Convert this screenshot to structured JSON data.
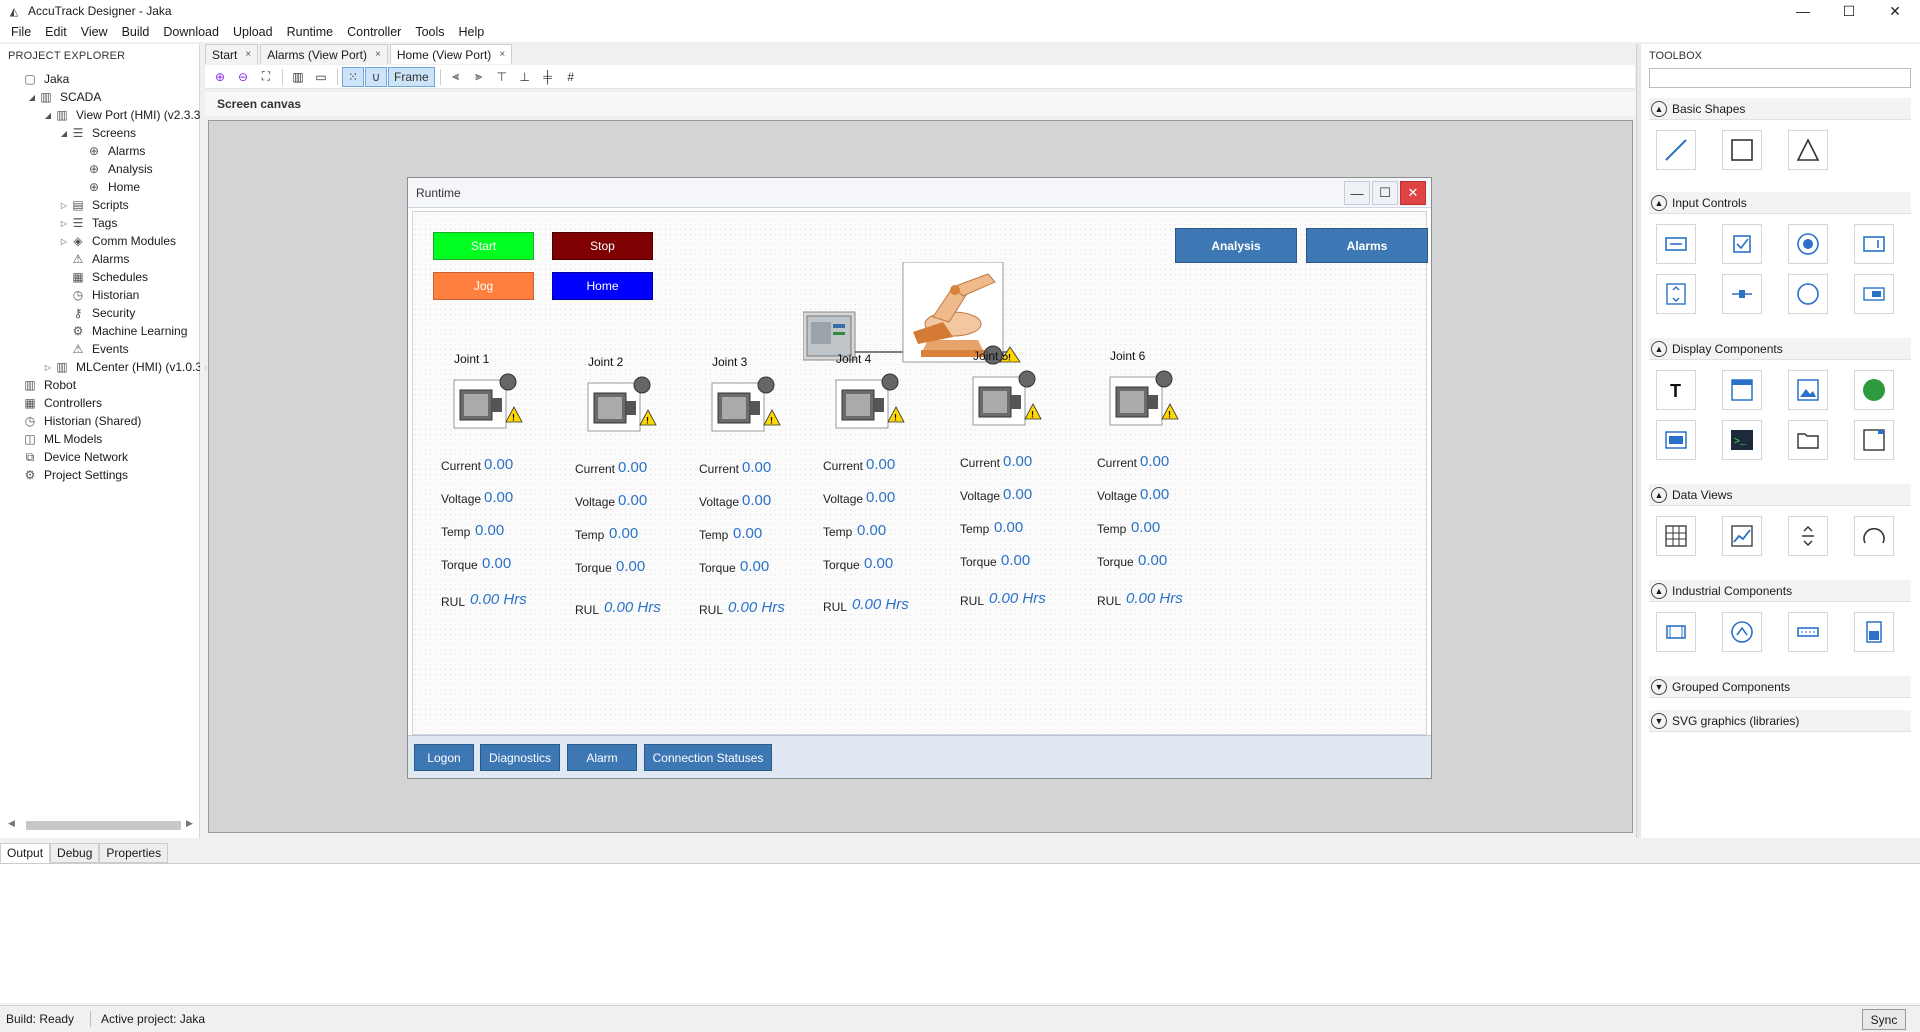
{
  "window": {
    "title": "AccuTrack Designer - Jaka",
    "min": "—",
    "max": "☐",
    "close": "✕"
  },
  "menu": [
    "File",
    "Edit",
    "View",
    "Build",
    "Download",
    "Upload",
    "Runtime",
    "Controller",
    "Tools",
    "Help"
  ],
  "explorer": {
    "header": "PROJECT EXPLORER",
    "items": [
      {
        "label": "Jaka",
        "icon": "file-icon",
        "arrow": ""
      },
      {
        "label": "SCADA",
        "icon": "library-icon",
        "arrow": "◢"
      },
      {
        "label": "View Port (HMI) (v2.3.3)",
        "icon": "library-icon",
        "arrow": "◢"
      },
      {
        "label": "Screens",
        "icon": "list-icon",
        "arrow": "◢"
      },
      {
        "label": "Alarms",
        "icon": "globe-icon",
        "arrow": ""
      },
      {
        "label": "Analysis",
        "icon": "globe-icon",
        "arrow": ""
      },
      {
        "label": "Home",
        "icon": "globe-icon",
        "arrow": ""
      },
      {
        "label": "Scripts",
        "icon": "script-icon",
        "arrow": "▷"
      },
      {
        "label": "Tags",
        "icon": "list-icon",
        "arrow": "▷"
      },
      {
        "label": "Comm Modules",
        "icon": "comm-icon",
        "arrow": "▷"
      },
      {
        "label": "Alarms",
        "icon": "warning-icon",
        "arrow": ""
      },
      {
        "label": "Schedules",
        "icon": "calendar-icon",
        "arrow": ""
      },
      {
        "label": "Historian",
        "icon": "history-icon",
        "arrow": ""
      },
      {
        "label": "Security",
        "icon": "key-icon",
        "arrow": ""
      },
      {
        "label": "Machine Learning",
        "icon": "gear-icon",
        "arrow": ""
      },
      {
        "label": "Events",
        "icon": "warning-icon",
        "arrow": ""
      },
      {
        "label": "MLCenter (HMI) (v1.0.3)",
        "icon": "library-icon",
        "arrow": "▷"
      },
      {
        "label": "Robot",
        "icon": "library-icon",
        "arrow": ""
      },
      {
        "label": "Controllers",
        "icon": "grid-icon",
        "arrow": ""
      },
      {
        "label": "Historian (Shared)",
        "icon": "history-icon",
        "arrow": ""
      },
      {
        "label": "ML Models",
        "icon": "cube-icon",
        "arrow": ""
      },
      {
        "label": "Device Network",
        "icon": "network-icon",
        "arrow": ""
      },
      {
        "label": "Project Settings",
        "icon": "gear-icon",
        "arrow": ""
      }
    ]
  },
  "tabs": [
    {
      "label": "Start",
      "close": "×"
    },
    {
      "label": "Alarms (View Port)",
      "close": "×"
    },
    {
      "label": "Home (View Port)",
      "close": "×"
    }
  ],
  "toolbar": {
    "frame_label": "Frame"
  },
  "canvas": {
    "label": "Screen canvas"
  },
  "runtime": {
    "title": "Runtime",
    "controls": {
      "start": "Start",
      "stop": "Stop",
      "jog": "Jog",
      "home": "Home"
    },
    "nav": {
      "analysis": "Analysis",
      "alarms": "Alarms"
    },
    "labels": {
      "current": "Current",
      "voltage": "Voltage",
      "temp": "Temp",
      "torque": "Torque",
      "rul": "RUL"
    },
    "joints": [
      {
        "name": "Joint 1",
        "current": "0.00",
        "voltage": "0.00",
        "temp": "0.00",
        "torque": "0.00",
        "rul": "0.00 Hrs"
      },
      {
        "name": "Joint 2",
        "current": "0.00",
        "voltage": "0.00",
        "temp": "0.00",
        "torque": "0.00",
        "rul": "0.00 Hrs"
      },
      {
        "name": "Joint 3",
        "current": "0.00",
        "voltage": "0.00",
        "temp": "0.00",
        "torque": "0.00",
        "rul": "0.00 Hrs"
      },
      {
        "name": "Joint 4",
        "current": "0.00",
        "voltage": "0.00",
        "temp": "0.00",
        "torque": "0.00",
        "rul": "0.00 Hrs"
      },
      {
        "name": "Joint 5",
        "current": "0.00",
        "voltage": "0.00",
        "temp": "0.00",
        "torque": "0.00",
        "rul": "0.00 Hrs"
      },
      {
        "name": "Joint 6",
        "current": "0.00",
        "voltage": "0.00",
        "temp": "0.00",
        "torque": "0.00",
        "rul": "0.00 Hrs"
      }
    ],
    "footer": {
      "logon": "Logon",
      "diagnostics": "Diagnostics",
      "alarm": "Alarm",
      "connection": "Connection Statuses"
    },
    "colors": {
      "start": "#00ff21",
      "stop": "#7f0000",
      "jog": "#ff7f3f",
      "home": "#0000ff",
      "nav": "#3e78b4"
    }
  },
  "toolbox": {
    "header": "TOOLBOX",
    "search_value": "",
    "sections": {
      "basic": "Basic Shapes",
      "input": "Input Controls",
      "display": "Display Components",
      "data": "Data Views",
      "industrial": "Industrial Components",
      "grouped": "Grouped Components",
      "svg": "SVG graphics (libraries)"
    }
  },
  "bottom": {
    "tabs": [
      "Output",
      "Debug",
      "Properties"
    ]
  },
  "status": {
    "build": "Build: Ready",
    "project": "Active project: Jaka",
    "sync": "Sync"
  }
}
